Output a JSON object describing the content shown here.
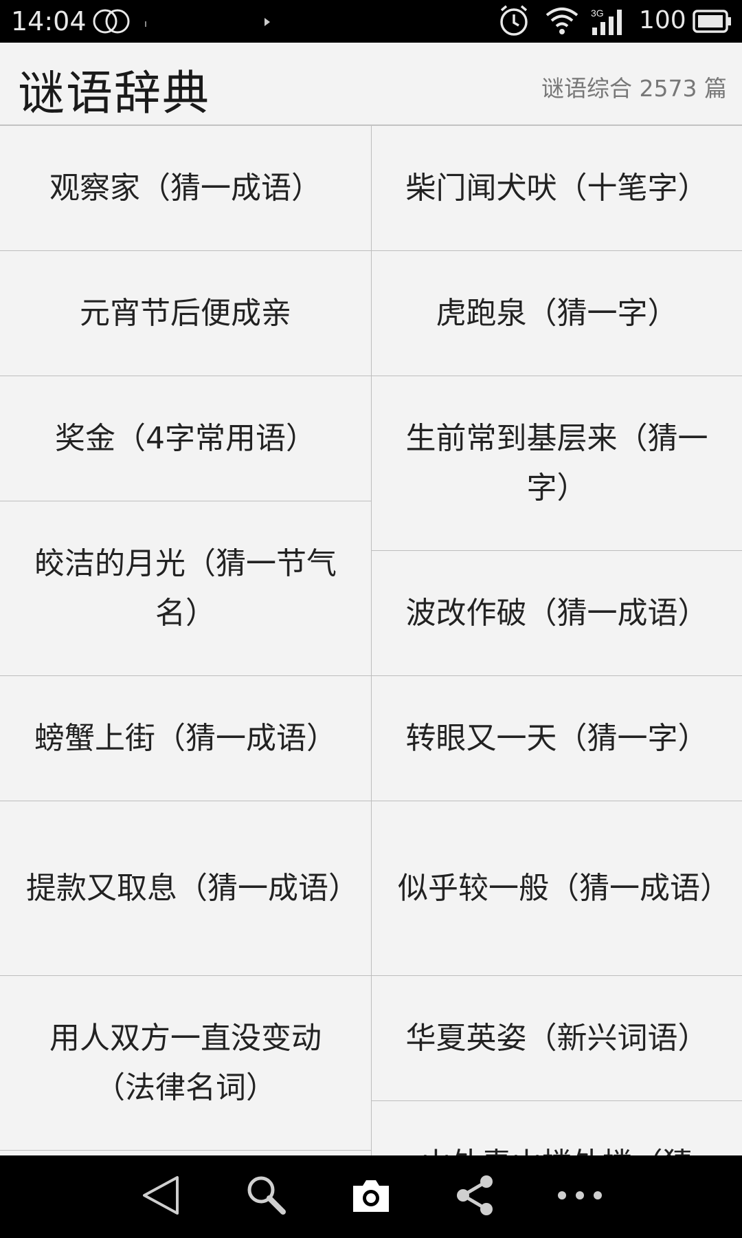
{
  "status_bar": {
    "time": "14:04",
    "network": "3G",
    "battery": "100",
    "icons": [
      "dual-circle-icon",
      "alarm-icon",
      "wifi-icon",
      "signal-icon",
      "battery-icon"
    ]
  },
  "header": {
    "title": "谜语辞典",
    "subtitle": "谜语综合 2573 篇"
  },
  "riddles": {
    "left": [
      "观察家（猜一成语）",
      "元宵节后便成亲",
      "奖金（4字常用语）",
      "皎洁的月光（猜一节气名）",
      "螃蟹上街（猜一成语）",
      "提款又取息（猜一成语）",
      "用人双方一直没变动（法律名词）"
    ],
    "right": [
      "柴门闻犬吠（十笔字）",
      "虎跑泉（猜一字）",
      "生前常到基层来（猜一字）",
      "波改作破（猜一成语）",
      "转眼又一天（猜一字）",
      "似乎较一般（猜一成语）",
      "华夏英姿（新兴词语）",
      "山外青山楼外楼（猜"
    ]
  },
  "nav_bar": {
    "icons": [
      "back-icon",
      "search-icon",
      "camera-icon",
      "share-icon",
      "more-icon"
    ]
  },
  "colors": {
    "background": "#f3f3f3",
    "divider": "#bdbdbd",
    "text": "#222222",
    "subtitle": "#777777",
    "bars": "#000000"
  }
}
